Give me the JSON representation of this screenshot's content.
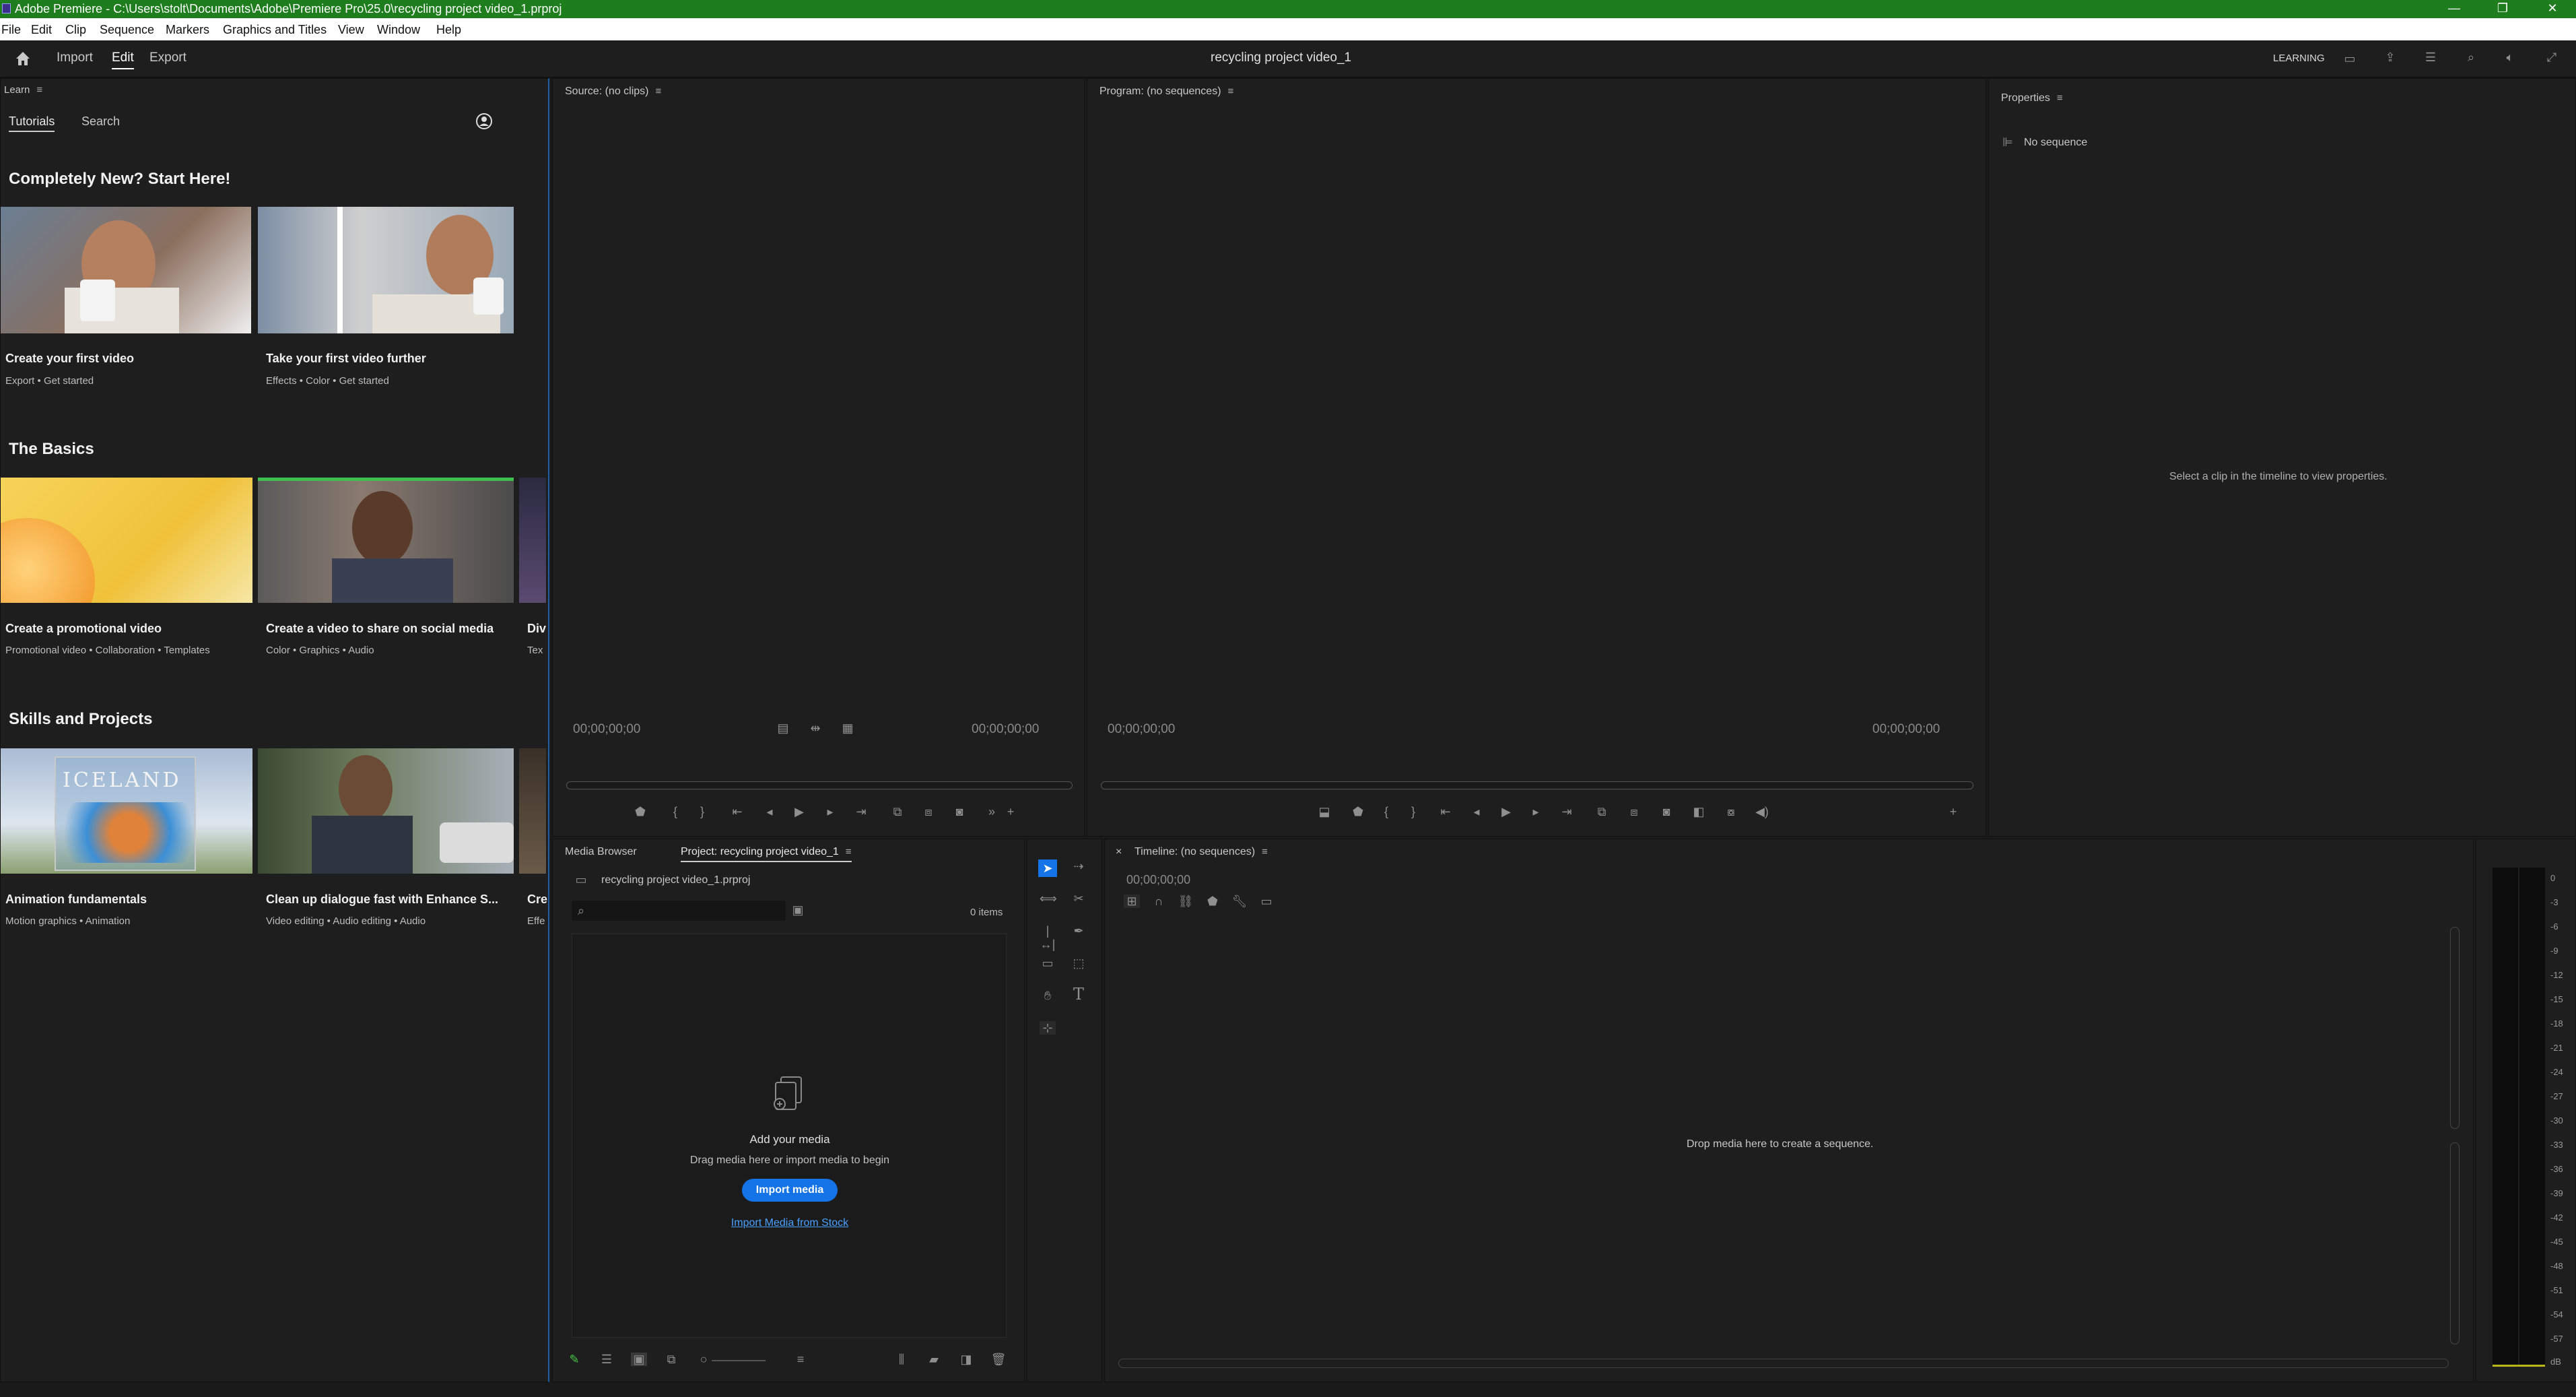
{
  "window": {
    "title": "Adobe Premiere - C:\\Users\\stolt\\Documents\\Adobe\\Premiere Pro\\25.0\\recycling project video_1.prproj",
    "controls": [
      "—",
      "❐",
      "✕"
    ]
  },
  "menu": [
    "File",
    "Edit",
    "Clip",
    "Sequence",
    "Markers",
    "Graphics and Titles",
    "View",
    "Window",
    "Help"
  ],
  "workspace": {
    "tabs": [
      "Import",
      "Edit",
      "Export"
    ],
    "active": "Edit",
    "project_name": "recycling project video_1",
    "learning_label": "LEARNING"
  },
  "learn": {
    "panel_title": "Learn",
    "tabs": [
      "Tutorials",
      "Search"
    ],
    "sections": [
      {
        "heading": "Completely New? Start Here!",
        "cards": [
          {
            "title": "Create your first video",
            "tags": "Export  •  Get started"
          },
          {
            "title": "Take your first video further",
            "tags": "Effects  •  Color  •  Get started"
          }
        ]
      },
      {
        "heading": "The Basics",
        "cards": [
          {
            "title": "Create a promotional video",
            "tags": "Promotional video  •  Collaboration  •  Templates"
          },
          {
            "title": "Create a video to share on social media",
            "tags": "Color  •  Graphics  •  Audio"
          },
          {
            "title": "Div",
            "tags": "Tex"
          }
        ]
      },
      {
        "heading": "Skills and Projects",
        "cards": [
          {
            "title": "Animation fundamentals",
            "tags": "Motion graphics  •  Animation",
            "thumb_text": "ICELAND"
          },
          {
            "title": "Clean up dialogue fast with Enhance S...",
            "tags": "Video editing  •  Audio editing  •  Audio"
          },
          {
            "title": "Cre",
            "tags": "Effe"
          }
        ]
      }
    ]
  },
  "source": {
    "title": "Source: (no clips)",
    "tc_left": "00;00;00;00",
    "tc_right": "00;00;00;00"
  },
  "program": {
    "title": "Program: (no sequences)",
    "tc_left": "00;00;00;00",
    "tc_right": "00;00;00;00"
  },
  "properties": {
    "title": "Properties",
    "no_sequence": "No sequence",
    "hint": "Select a clip in the timeline to view properties."
  },
  "project": {
    "tabs": [
      "Media Browser",
      "Project: recycling project video_1"
    ],
    "file": "recycling project video_1.prproj",
    "items_count": "0 items",
    "add_media_title": "Add your media",
    "add_media_sub": "Drag media here or import media to begin",
    "import_button": "Import media",
    "stock_link": "Import Media from Stock"
  },
  "timeline": {
    "title": "Timeline: (no sequences)",
    "close": "×",
    "timecode": "00;00;00;00",
    "drop_hint": "Drop media here to create a sequence."
  },
  "audio_meter": {
    "scale": [
      "0",
      "-3",
      "-6",
      "-9",
      "-12",
      "-15",
      "-18",
      "-21",
      "-24",
      "-27",
      "-30",
      "-33",
      "-36",
      "-39",
      "-42",
      "-45",
      "-48",
      "-51",
      "-54",
      "-57",
      "dB"
    ]
  },
  "colors": {
    "accent": "#1473e6",
    "titlebar": "#1e7e1e",
    "panel": "#1e1e1e"
  }
}
